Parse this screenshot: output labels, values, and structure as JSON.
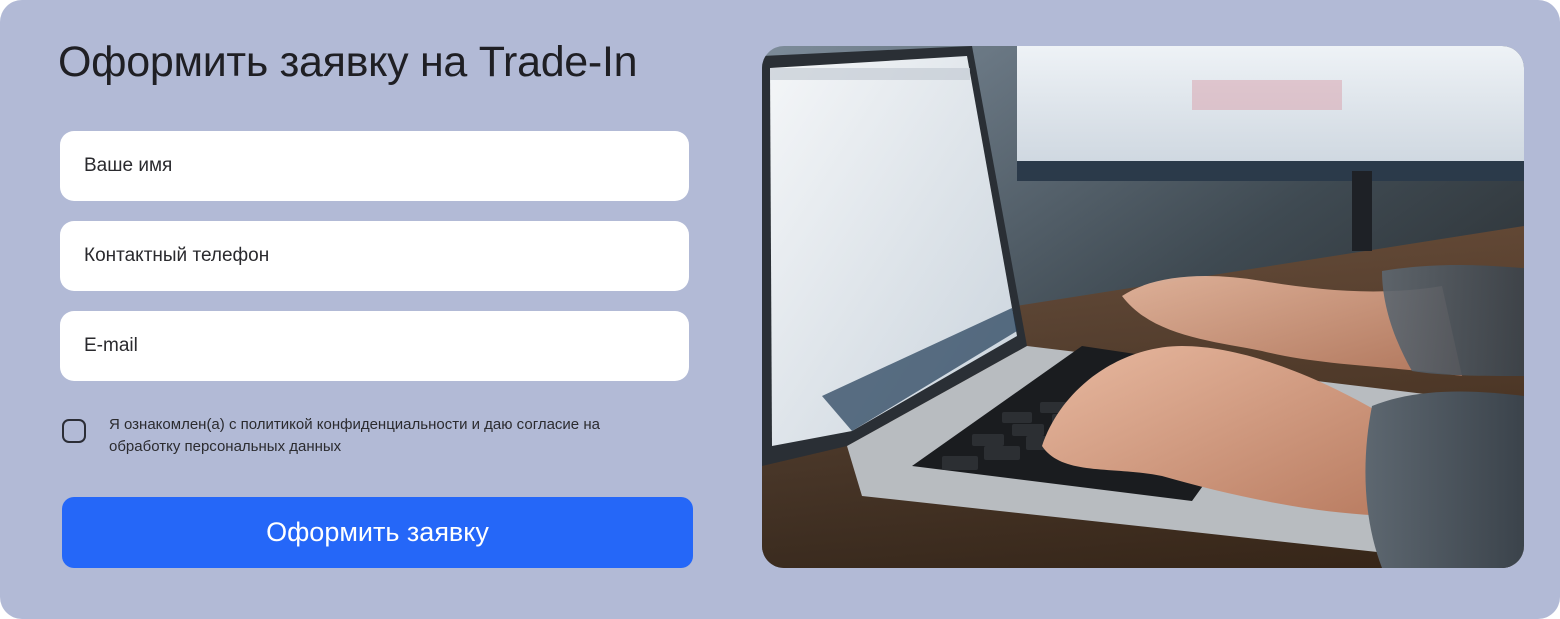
{
  "form": {
    "title": "Оформить заявку на Trade-In",
    "fields": {
      "name_placeholder": "Ваше имя",
      "phone_placeholder": "Контактный телефон",
      "email_placeholder": "E-mail"
    },
    "consent": {
      "checked": false,
      "text": "Я ознакомлен(а) с политикой конфиденциальности и даю согласие на обработку персональных данных"
    },
    "submit_label": "Оформить заявку"
  },
  "colors": {
    "background": "#b2bad6",
    "field_background": "#ffffff",
    "accent": "#2567f8"
  }
}
